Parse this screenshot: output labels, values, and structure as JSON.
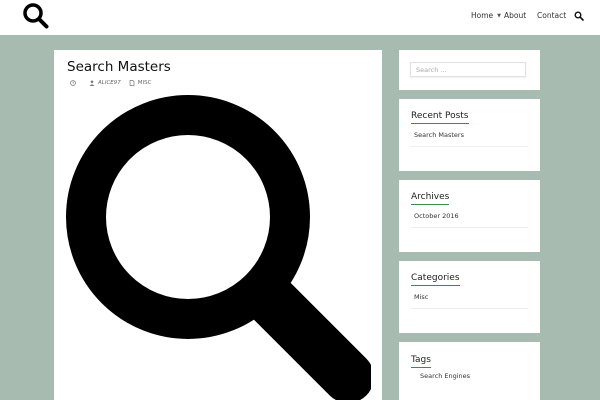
{
  "nav": {
    "items": [
      {
        "label": "Home",
        "has_dropdown": true
      },
      {
        "label": "About"
      },
      {
        "label": "Contact"
      }
    ],
    "search_icon": "search-icon"
  },
  "post": {
    "title": "Search Masters",
    "author": "ALICE97",
    "category": "MISC",
    "image_icon": "magnifier-icon"
  },
  "sidebar": {
    "search_placeholder": "Search ...",
    "recent_posts": {
      "title": "Recent Posts",
      "items": [
        "Search Masters"
      ]
    },
    "archives": {
      "title": "Archives",
      "items": [
        "October 2016"
      ]
    },
    "categories": {
      "title": "Categories",
      "items": [
        "Misc"
      ]
    },
    "tags": {
      "title": "Tags",
      "items": [
        "Search Engines"
      ]
    }
  },
  "colors": {
    "background": "#a7bbb1",
    "accent_underline": "#3c8a4f",
    "panel": "#ffffff"
  }
}
